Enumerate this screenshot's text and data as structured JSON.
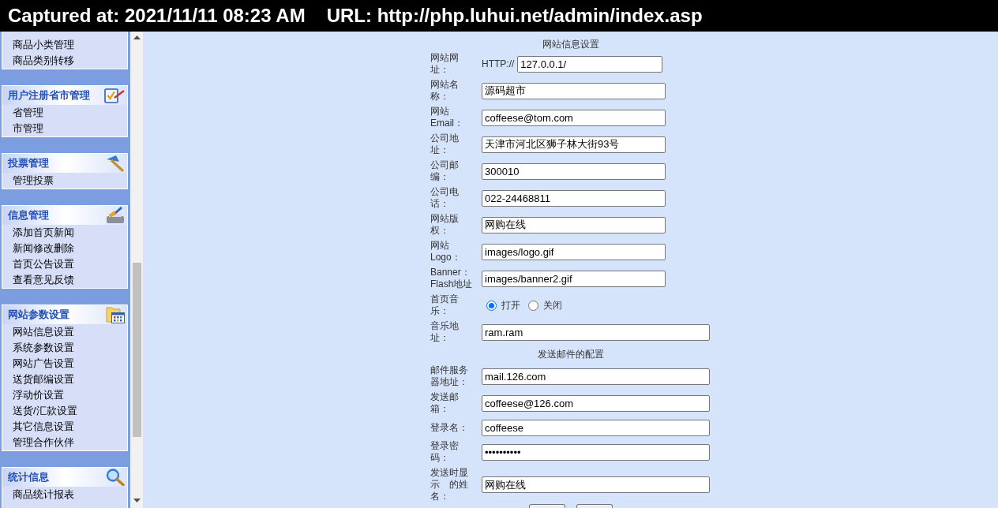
{
  "capture_banner": {
    "captured_at": "Captured at: 2021/11/11 08:23 AM",
    "url": "URL: http://php.luhui.net/admin/index.asp"
  },
  "sidebar": {
    "panels": [
      {
        "items": [
          "商品小类管理",
          "商品类别转移"
        ]
      },
      {
        "title": "用户注册省市管理",
        "kind": "region",
        "items": [
          "省管理",
          "市管理"
        ]
      },
      {
        "title": "投票管理",
        "kind": "poll",
        "items": [
          "管理投票"
        ]
      },
      {
        "title": "信息管理",
        "kind": "news",
        "items": [
          "添加首页新闻",
          "新闻修改删除",
          "首页公告设置",
          "查看意见反馈"
        ]
      },
      {
        "title": "网站参数设置",
        "kind": "settings",
        "items": [
          "网站信息设置",
          "系统参数设置",
          "网站广告设置",
          "送货邮编设置",
          "浮动价设置",
          "送货/汇款设置",
          "其它信息设置",
          "管理合作伙伴"
        ]
      },
      {
        "title": "统计信息",
        "kind": "stats",
        "items": [
          "商品统计报表"
        ]
      }
    ]
  },
  "form": {
    "sections": [
      {
        "title": "网站信息设置",
        "rows": [
          {
            "kind": "url",
            "label": "网站网址：",
            "prefix": "HTTP://",
            "value": "127.0.0.1/"
          },
          {
            "kind": "text",
            "label": "网站名称：",
            "value": "源码超市"
          },
          {
            "kind": "text",
            "label": "网站Email：",
            "value": "coffeese@tom.com"
          },
          {
            "kind": "text",
            "label": "公司地址：",
            "value": "天津市河北区狮子林大街93号"
          },
          {
            "kind": "text",
            "label": "公司邮编：",
            "value": "300010"
          },
          {
            "kind": "text",
            "label": "公司电话：",
            "value": "022-24468811"
          },
          {
            "kind": "text",
            "label": "网站版权：",
            "value": "网购在线"
          },
          {
            "kind": "text",
            "label": "网站Logo：",
            "value": "images/logo.gif"
          },
          {
            "kind": "text",
            "label": "Banner：Flash地址",
            "value": "images/banner2.gif"
          },
          {
            "kind": "radio",
            "label": "首页音乐：",
            "options": [
              {
                "label": "打开",
                "selected": true
              },
              {
                "label": "关闭",
                "selected": false
              }
            ]
          },
          {
            "kind": "wide",
            "label": "音乐地址：",
            "value": "ram.ram"
          }
        ]
      },
      {
        "title": "发送邮件的配置",
        "rows": [
          {
            "kind": "wide",
            "label": "邮件服务器地址：",
            "value": "mail.126.com"
          },
          {
            "kind": "wide",
            "label": "发送邮箱：",
            "value": "coffeese@126.com"
          },
          {
            "kind": "wide",
            "label": "登录名：",
            "value": "coffeese"
          },
          {
            "kind": "password",
            "label": "登录密码：",
            "value": "••••••••••"
          },
          {
            "kind": "wide",
            "label": "发送时显示　的姓名：",
            "value": "网购在线"
          }
        ]
      }
    ],
    "buttons": [
      {
        "kind": "button"
      },
      {
        "kind": "button"
      }
    ]
  }
}
